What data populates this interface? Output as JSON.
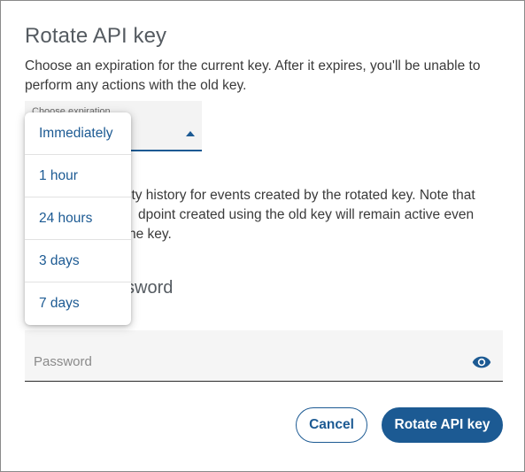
{
  "dialog": {
    "title": "Rotate API key",
    "description": "Choose an expiration for the current key. After it expires, you'll be unable to perform any actions with the old key.",
    "expiration_select": {
      "label": "Choose expiration"
    },
    "note_visible": "ity history for events created by the rotated key. Note that\ndpoint created using the old key will remain active even\nhe key.",
    "password_section_heading_visible": "ssword",
    "password_field": {
      "placeholder": "Password",
      "value": ""
    },
    "icons": {
      "visibility": "eye-icon",
      "dropdown_caret": "caret-up-icon"
    },
    "buttons": {
      "cancel": "Cancel",
      "rotate": "Rotate API key"
    },
    "dropdown": {
      "options": [
        "Immediately",
        "1 hour",
        "24 hours",
        "3 days",
        "7 days"
      ]
    },
    "colors": {
      "accent": "#1c5a93",
      "title": "#555b61"
    }
  }
}
